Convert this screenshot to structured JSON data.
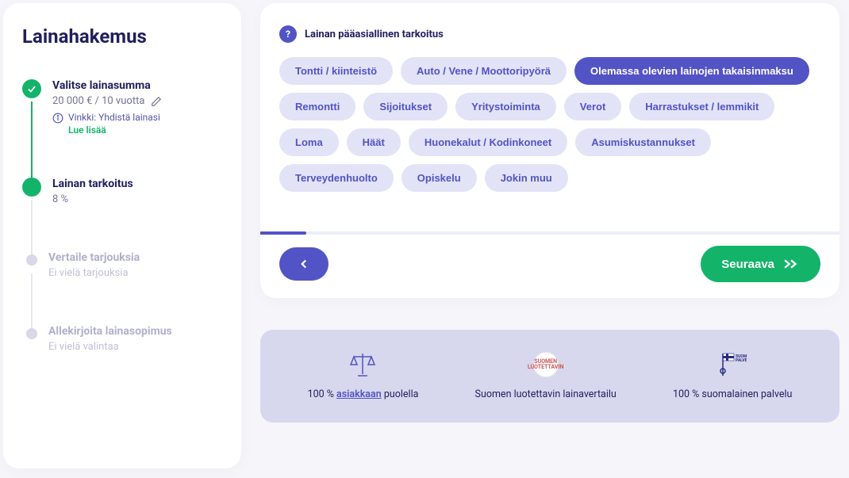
{
  "sidebar": {
    "title": "Lainahakemus",
    "steps": [
      {
        "title": "Valitse lainasumma",
        "sub": "20 000 € / 10 vuotta",
        "tip_label": "Vinkki: Yhdistä lainasi",
        "tip_link": "Lue lisää"
      },
      {
        "title": "Lainan tarkoitus",
        "sub": "8 %"
      },
      {
        "title": "Vertaile tarjouksia",
        "sub": "Ei vielä tarjouksia"
      },
      {
        "title": "Allekirjoita lainasopimus",
        "sub": "Ei vielä valintaa"
      }
    ]
  },
  "question": {
    "label": "Lainan pääasiallinen tarkoitus",
    "options": [
      {
        "label": "Tontti / kiinteistö",
        "selected": false
      },
      {
        "label": "Auto / Vene / Moottoripyörä",
        "selected": false
      },
      {
        "label": "Olemassa olevien lainojen takaisinmaksu",
        "selected": true
      },
      {
        "label": "Remontti",
        "selected": false
      },
      {
        "label": "Sijoitukset",
        "selected": false
      },
      {
        "label": "Yritystoiminta",
        "selected": false
      },
      {
        "label": "Verot",
        "selected": false
      },
      {
        "label": "Harrastukset / lemmikit",
        "selected": false
      },
      {
        "label": "Loma",
        "selected": false
      },
      {
        "label": "Häät",
        "selected": false
      },
      {
        "label": "Huonekalut / Kodinkoneet",
        "selected": false
      },
      {
        "label": "Asumiskustannukset",
        "selected": false
      },
      {
        "label": "Terveydenhuolto",
        "selected": false
      },
      {
        "label": "Opiskelu",
        "selected": false
      },
      {
        "label": "Jokin muu",
        "selected": false
      }
    ]
  },
  "progress_percent": 8,
  "nav": {
    "next_label": "Seuraava"
  },
  "trust": [
    {
      "prefix": "100 % ",
      "highlight": "asiakkaan",
      "suffix": " puolella"
    },
    {
      "text": "Suomen luotettavin lainavertailu"
    },
    {
      "text": "100 % suomalainen palvelu"
    }
  ]
}
